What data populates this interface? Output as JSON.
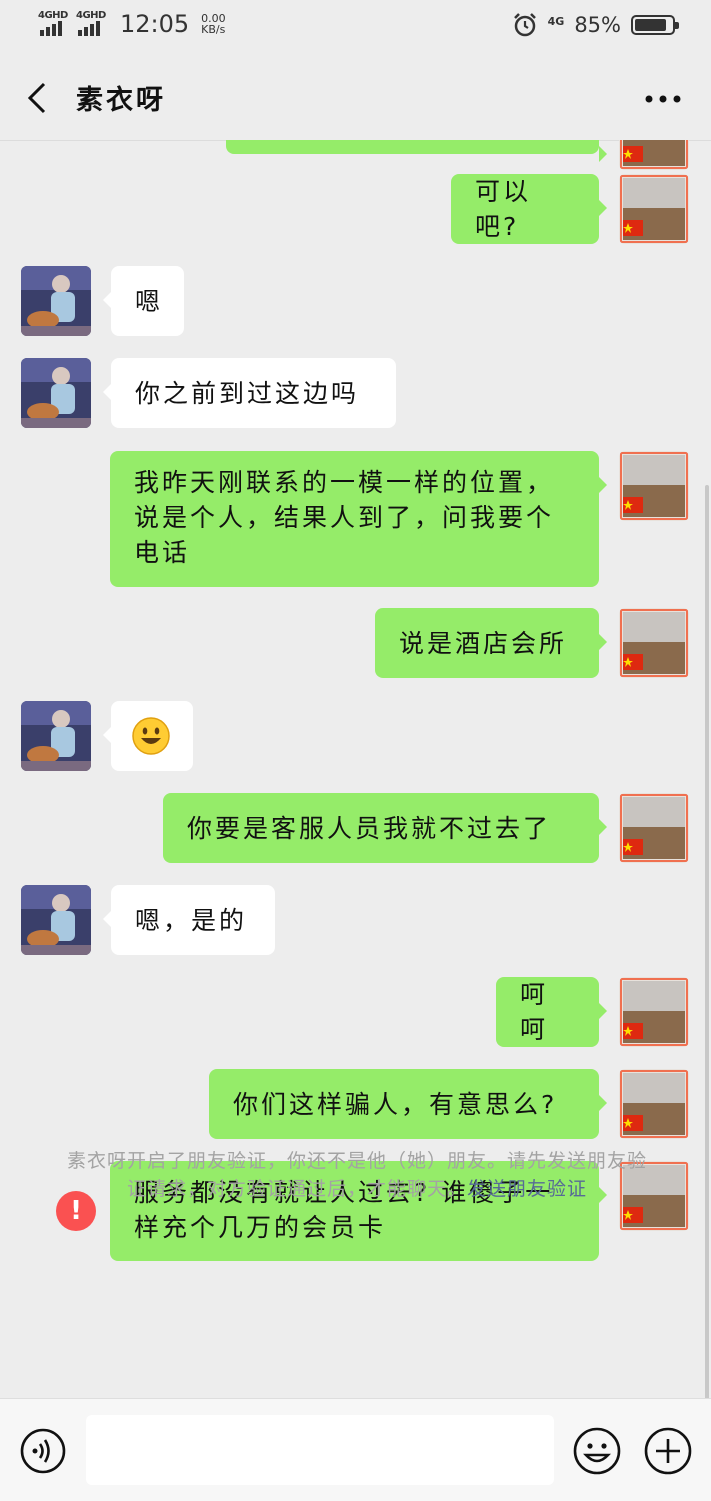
{
  "status_bar": {
    "network_1": "4GHD",
    "network_2": "4GHD",
    "time": "12:05",
    "speed_value": "0.00",
    "speed_unit": "KB/s",
    "alarm_icon": "alarm-icon",
    "mobile_data": "4G",
    "battery_percent": "85%",
    "battery_level": 0.85
  },
  "header": {
    "back_icon": "chevron-left-icon",
    "title": "素衣呀",
    "more_icon": "more-dots-icon"
  },
  "messages": [
    {
      "side": "sent",
      "text": ""
    },
    {
      "side": "sent",
      "text": "可以吧?"
    },
    {
      "side": "recv",
      "text": "嗯"
    },
    {
      "side": "recv",
      "text": "你之前到过这边吗"
    },
    {
      "side": "sent",
      "text": "我昨天刚联系的一模一样的位置，说是个人，结果人到了，问我要个电话"
    },
    {
      "side": "sent",
      "text": "说是酒店会所"
    },
    {
      "side": "recv",
      "text": "😃"
    },
    {
      "side": "sent",
      "text": "你要是客服人员我就不过去了"
    },
    {
      "side": "recv",
      "text": "嗯，是的"
    },
    {
      "side": "sent",
      "text": "呵呵"
    },
    {
      "side": "sent",
      "text": "你们这样骗人，有意思么?"
    },
    {
      "side": "sent",
      "text": "服务都没有就让人过去? 谁傻子一样充个几万的会员卡",
      "failed": true
    }
  ],
  "failed_icon_text": "!",
  "system_note": {
    "text": "素衣呀开启了朋友验证，你还不是他（她）朋友。请先发送朋友验证请求，对方验证通过后，才能聊天。",
    "link": "发送朋友验证"
  },
  "input_bar": {
    "voice_icon": "voice-icon",
    "emoji_icon": "emoji-icon",
    "plus_icon": "plus-icon"
  },
  "colors": {
    "sent_bubble": "#95ec69",
    "recv_bubble": "#ffffff",
    "background": "#ededed",
    "link": "#576b95",
    "error": "#fa5151"
  }
}
